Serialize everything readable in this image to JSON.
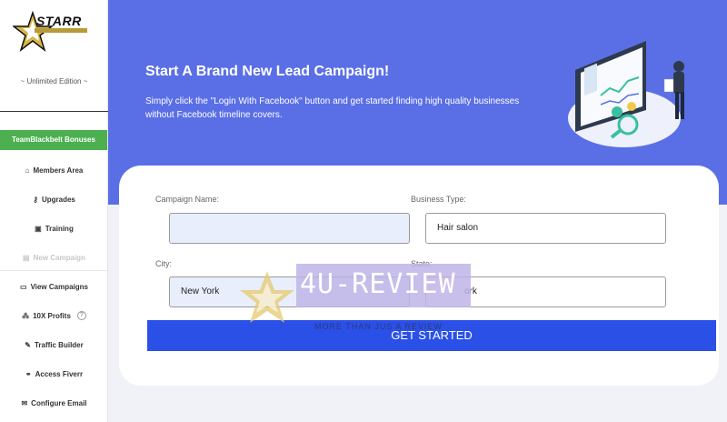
{
  "sidebar": {
    "logo_text": "STARR",
    "edition": "~ Unlimited Edition ~",
    "bonus_button": "TeamBlackbelt Bonuses",
    "items": [
      {
        "icon": "home-icon",
        "glyph": "⌂",
        "label": "Members Area"
      },
      {
        "icon": "key-icon",
        "glyph": "⚷",
        "label": "Upgrades"
      },
      {
        "icon": "training-icon",
        "glyph": "▣",
        "label": "Training"
      },
      {
        "icon": "new-campaign-icon",
        "glyph": "▤",
        "label": "New Campaign"
      },
      {
        "icon": "view-campaigns-icon",
        "glyph": "▭",
        "label": "View Campaigns"
      },
      {
        "icon": "profits-icon",
        "glyph": "⁂",
        "label": "10X Profits"
      },
      {
        "icon": "wrench-icon",
        "glyph": "✎",
        "label": "Traffic Builder"
      },
      {
        "icon": "link-icon",
        "glyph": "⚭",
        "label": "Access Fiverr"
      },
      {
        "icon": "envelope-icon",
        "glyph": "✉",
        "label": "Configure Email"
      }
    ],
    "help_glyph": "?"
  },
  "hero": {
    "title": "Start A Brand New Lead Campaign!",
    "text": "Simply click the \"Login With Facebook\" button and get started finding high quality businesses without Facebook timeline covers."
  },
  "form": {
    "campaign_label": "Campaign Name:",
    "campaign_value": "",
    "business_label": "Business Type:",
    "business_value": "Hair salon",
    "city_label": "City:",
    "city_value": "New York",
    "state_label": "State:",
    "state_value": "ork",
    "submit": "GET STARTED"
  },
  "watermark": {
    "title": "4U-REVIEW",
    "subtitle": "MORE THAN JUS A REVIEW"
  },
  "colors": {
    "hero": "#5a6fe6",
    "button": "#2b50e8",
    "bonus": "#4caf50",
    "gold": "#d9b64a"
  }
}
